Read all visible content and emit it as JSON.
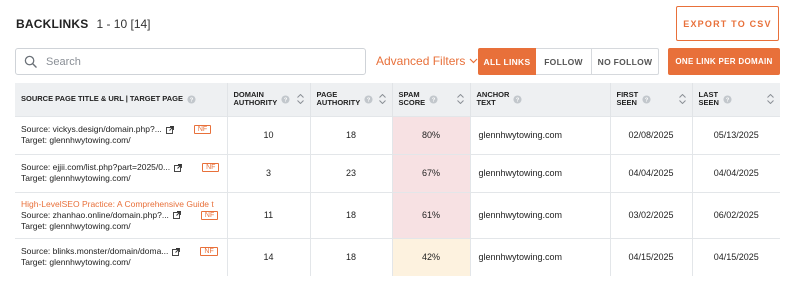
{
  "header": {
    "title": "BACKLINKS",
    "range": "1 - 10 [14]",
    "export_label": "EXPORT TO CSV"
  },
  "search": {
    "placeholder": "Search",
    "value": ""
  },
  "filters": {
    "advanced_label": "Advanced Filters",
    "segments": [
      "ALL LINKS",
      "FOLLOW",
      "NO FOLLOW"
    ],
    "selected_segment": "ALL LINKS",
    "one_link_label": "ONE LINK PER DOMAIN"
  },
  "colors": {
    "accent": "#e8703a",
    "spam_high": "#f7e1e3",
    "spam_mid": "#fdf2df",
    "header_bg": "#eef0f2"
  },
  "table": {
    "columns": {
      "source": "SOURCE PAGE TITLE & URL | TARGET PAGE",
      "domain_authority_1": "DOMAIN",
      "domain_authority_2": "AUTHORITY",
      "page_authority_1": "PAGE",
      "page_authority_2": "AUTHORITY",
      "spam_1": "SPAM",
      "spam_2": "SCORE",
      "anchor_1": "ANCHOR",
      "anchor_2": "TEXT",
      "first_1": "FIRST",
      "first_2": "SEEN",
      "last_1": "LAST",
      "last_2": "SEEN"
    },
    "rows": [
      {
        "page_title": "",
        "source": "Source: vickys.design/domain.php?...",
        "target": "Target: glennhwytowing.com/",
        "nf": "NF",
        "domain_authority": "10",
        "page_authority": "18",
        "spam_score": "80%",
        "anchor_text": "glennhwytowing.com",
        "first_seen": "02/08/2025",
        "last_seen": "05/13/2025"
      },
      {
        "page_title": "",
        "source": "Source: ejjii.com/list.php?part=2025/0...",
        "target": "Target: glennhwytowing.com/",
        "nf": "NF",
        "domain_authority": "3",
        "page_authority": "23",
        "spam_score": "67%",
        "anchor_text": "glennhwytowing.com",
        "first_seen": "04/04/2025",
        "last_seen": "04/04/2025"
      },
      {
        "page_title": "High-LevelSEO Practice: A Comprehensive Guide t",
        "source": "Source: zhanhao.online/domain.php?...",
        "target": "Target: glennhwytowing.com/",
        "nf": "NF",
        "domain_authority": "11",
        "page_authority": "18",
        "spam_score": "61%",
        "anchor_text": "glennhwytowing.com",
        "first_seen": "03/02/2025",
        "last_seen": "06/02/2025"
      },
      {
        "page_title": "",
        "source": "Source: blinks.monster/domain/doma...",
        "target": "Target: glennhwytowing.com/",
        "nf": "NF",
        "domain_authority": "14",
        "page_authority": "18",
        "spam_score": "42%",
        "anchor_text": "glennhwytowing.com",
        "first_seen": "04/15/2025",
        "last_seen": "04/15/2025"
      }
    ]
  }
}
